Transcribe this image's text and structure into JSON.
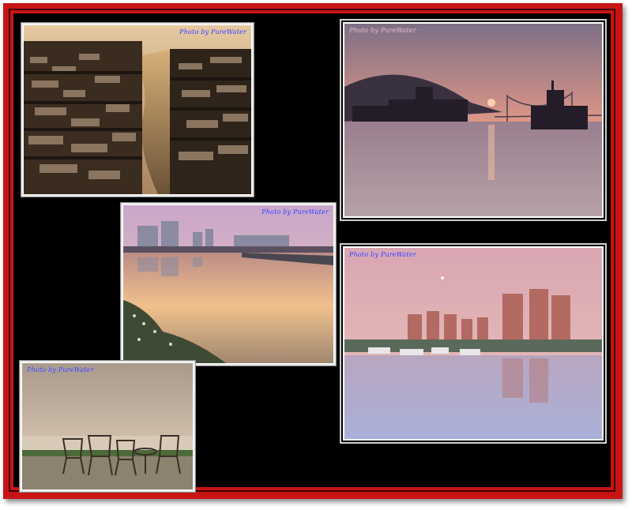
{
  "collage": {
    "frame_color": "#c81414",
    "background_color": "#000000",
    "photos": [
      {
        "caption": "Photo by  PureWater"
      },
      {
        "caption": "Photo by  PureWater"
      },
      {
        "caption": "Photo by  PureWater"
      },
      {
        "caption": "Photo by  PureWater"
      },
      {
        "caption": "Photo by  PureWater"
      }
    ]
  }
}
